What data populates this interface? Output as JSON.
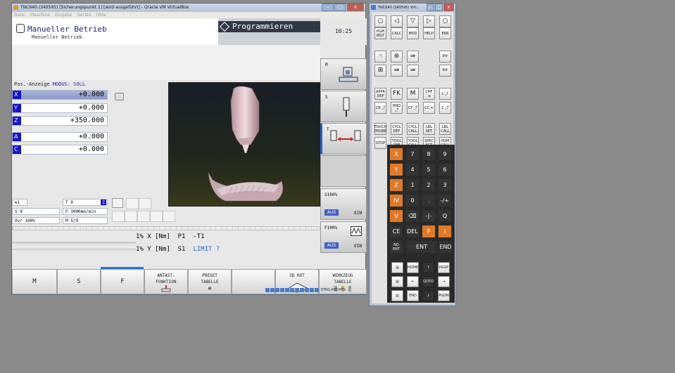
{
  "main_window": {
    "title": "TNC640 (340595) [Sicherungspunkt 1] [wird ausgeführt] - Oracle VM VirtualBox",
    "window_buttons": [
      "‒",
      "□",
      "x"
    ],
    "menu": [
      "Datei",
      "Maschine",
      "Eingabe",
      "Geräte",
      "Hilfe"
    ],
    "mode_title": "Manueller Betrieb",
    "mode_subtitle": "Manueller Betrieb",
    "programming_label": "Programmieren",
    "clock": "10:25",
    "position_header": "Pos.-Anzeige",
    "position_mode": "MODUS: SOLL",
    "axes": [
      {
        "name": "X",
        "value": "+0.000"
      },
      {
        "name": "Y",
        "value": "+0.000"
      },
      {
        "name": "Z",
        "value": "+350.000"
      },
      {
        "name": "A",
        "value": "+0.000"
      },
      {
        "name": "C",
        "value": "+0.000"
      }
    ],
    "status": {
      "tool_icon_label": "1",
      "tool": "T 0",
      "tool_axis": "Z",
      "spindle": "S 0",
      "feed": "F 3000mm/min",
      "override": "Ovr 100%",
      "m_function": "M 5/9"
    },
    "torque_lines": [
      {
        "pct": "1%",
        "axis": "X",
        "unit": "[Nm]",
        "label": "P1",
        "value": "-T1"
      },
      {
        "pct": "1%",
        "axis": "Y",
        "unit": "[Nm]",
        "label": "S1",
        "value": "LIMIT ?"
      }
    ],
    "side_softkeys": {
      "m": "M",
      "s": "S",
      "t": "T",
      "s_override": "S100%",
      "s_aus": "AUS",
      "s_ein": "EIN",
      "f_override": "F100%",
      "f_aus": "AUS",
      "f_ein": "EIN"
    },
    "softkeys": [
      {
        "label": "M"
      },
      {
        "label": "S"
      },
      {
        "label": "F"
      },
      {
        "label": "ANTAST-\nFUNKTION"
      },
      {
        "label": "PRESET\nTABELLE"
      },
      {
        "label": ""
      },
      {
        "label": "3D ROT"
      },
      {
        "label": "WERKZEUG\nTABELLE"
      }
    ],
    "statusbar_text": "STRG-RECHTS"
  },
  "keyboard_window": {
    "title": "TNC640 (340595) Virt...",
    "nav_keys": [
      "○",
      "◁",
      "▽",
      "▷",
      "○"
    ],
    "row2": [
      "PGM MGT",
      "CALC",
      "MOD",
      "HELP",
      "ERR"
    ],
    "row3": [
      "☝",
      "⊛",
      "⇛",
      "",
      "⇰"
    ],
    "row4": [
      "⊞",
      "⇛",
      "⇛",
      "",
      "⇰"
    ],
    "row5": [
      "APPR DEP",
      "FK",
      "M",
      "CHF ⇲",
      "L ⤴"
    ],
    "row6": [
      "CR ⤴",
      "RND ⤴",
      "CT ⤴",
      "CC +",
      "C ⤴"
    ],
    "row7": [
      "TOUCH PROBE",
      "CYCL DEF",
      "CYCL CALL",
      "LBL SET",
      "LBL CALL"
    ],
    "row8": [
      "STOP",
      "TOOL DEF",
      "TOOL CALL",
      "SPEC FCT",
      "PGM CALL"
    ],
    "numpad": [
      [
        "X",
        "7",
        "8",
        "9"
      ],
      [
        "Y",
        "4",
        "5",
        "6"
      ],
      [
        "Z",
        "1",
        "2",
        "3"
      ],
      [
        "IV",
        "0",
        ".",
        "-/+"
      ],
      [
        "V",
        "⌫",
        "-|-",
        "Q"
      ],
      [
        "CE",
        "DEL",
        "P",
        "I"
      ],
      [
        "NO ENT",
        "ENT",
        "END"
      ]
    ],
    "editkeys": [
      [
        "▤",
        "HOME",
        "↑",
        "PGUP"
      ],
      [
        "▤",
        "←",
        "GOTO",
        "→"
      ],
      [
        "▤",
        "END",
        "↓",
        "PGDN"
      ]
    ]
  }
}
